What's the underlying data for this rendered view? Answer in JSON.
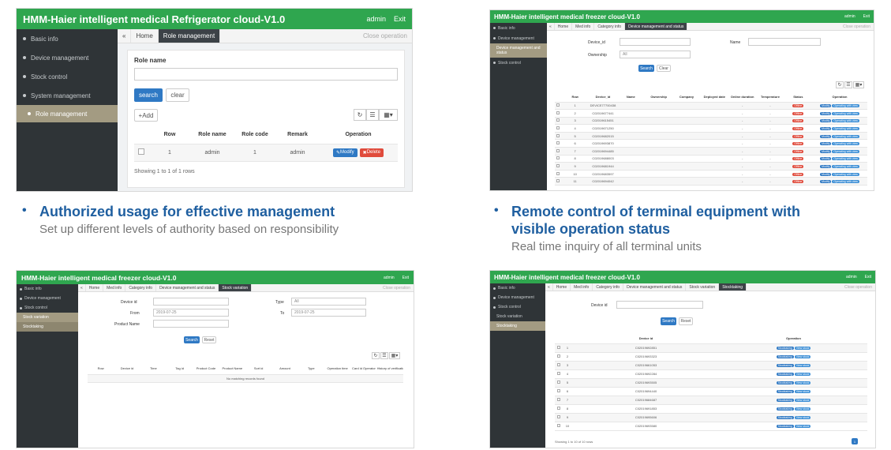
{
  "screens": {
    "role": {
      "title": "HMM-Haier intelligent medical Refrigerator cloud-V1.0",
      "user": "admin",
      "exit": "Exit",
      "sidebar": [
        "Basic info",
        "Device management",
        "Stock control",
        "System management",
        "Role management"
      ],
      "tabs": [
        "Home",
        "Role management"
      ],
      "tabs_right": "Close operation",
      "field_label": "Role name",
      "search_btn": "search",
      "clear_btn": "clear",
      "add_btn": "Add",
      "columns": [
        "Row",
        "Role name",
        "Role code",
        "Remark",
        "Operation"
      ],
      "row": [
        "1",
        "admin",
        "1",
        "admin"
      ],
      "modify_btn": "Modify",
      "delete_btn": "Delete",
      "footer": "Showing 1 to 1 of 1 rows"
    },
    "status": {
      "title": "HMM-Haier intelligent medical freezer cloud-V1.0",
      "sidebar": [
        "Basic info",
        "Device management",
        "Device management and status",
        "Stock control"
      ],
      "tabs": [
        "Home",
        "Med info",
        "Category info",
        "Device management and status"
      ],
      "field1": "Device_id",
      "field2": "Name",
      "field3": "Ownership",
      "field3_val": "All",
      "search_btn": "Search",
      "clear_btn": "Clear",
      "columns": [
        "Row",
        "Device_id",
        "Name",
        "Ownership",
        "Company",
        "Deployed date",
        "Online duration",
        "Temperature",
        "Status",
        "Operation"
      ],
      "ids": [
        "DEVICE77700438",
        "C02019677441",
        "C02019615451",
        "C02019671250",
        "C02019682015",
        "C02019693870",
        "C02019694485",
        "C02019688003",
        "C02019681944",
        "C02019683597",
        "C02019694042"
      ],
      "status_label": "Offline",
      "op1": "Modify",
      "op2": "Operating with view"
    },
    "stock": {
      "title": "HMM-Haier intelligent medical freezer cloud-V1.0",
      "sidebar": [
        "Basic info",
        "Device management",
        "Stock control",
        "Stock variation",
        "Stocktaking"
      ],
      "tabs": [
        "Home",
        "Med info",
        "Category info",
        "Device management and status",
        "Stock variation"
      ],
      "labels": [
        "Device id",
        "From",
        "Product Name",
        "Type",
        "To"
      ],
      "from_val": "2019-07-25",
      "to_val": "2019-07-25",
      "type_val": "All",
      "search_btn": "Search",
      "reset_btn": "Reset",
      "columns": [
        "Row",
        "Device id",
        "Time",
        "Tag id",
        "Product Code",
        "Product Name",
        "Sort id",
        "Amount",
        "Type",
        "Operation time",
        "Card id Operator",
        "History of verification"
      ],
      "empty": "No matching records found"
    },
    "stocktaking": {
      "title": "HMM-Haier intelligent medical freezer cloud-V1.0",
      "sidebar": [
        "Basic info",
        "Device management",
        "Stock control",
        "Stock variation",
        "Stocktaking"
      ],
      "tabs": [
        "Home",
        "Med info",
        "Category info",
        "Device management and status",
        "Stock variation",
        "Stocktaking"
      ],
      "label": "Device id",
      "search_btn": "Search",
      "reset_btn": "Reset",
      "columns": [
        "Device id",
        "Operation"
      ],
      "ids": [
        "C02019692851",
        "C02019693323",
        "C02019661053",
        "C02019692284",
        "C02019693505",
        "C02019694440",
        "C02019684687",
        "C02019691853",
        "C02019695606",
        "C02019693580"
      ],
      "op1": "Stocktaking",
      "op2": "View stock",
      "footer": "Showing 1 to 10 of 10 rows"
    }
  },
  "captions": {
    "c1": {
      "heading": "Authorized usage for effective management",
      "sub": "Set up different levels of authority based on responsibility"
    },
    "c2": {
      "heading_line1": "Remote control of terminal equipment with",
      "heading_line2": "visible operation status",
      "sub": "Real time inquiry of all terminal units"
    }
  }
}
